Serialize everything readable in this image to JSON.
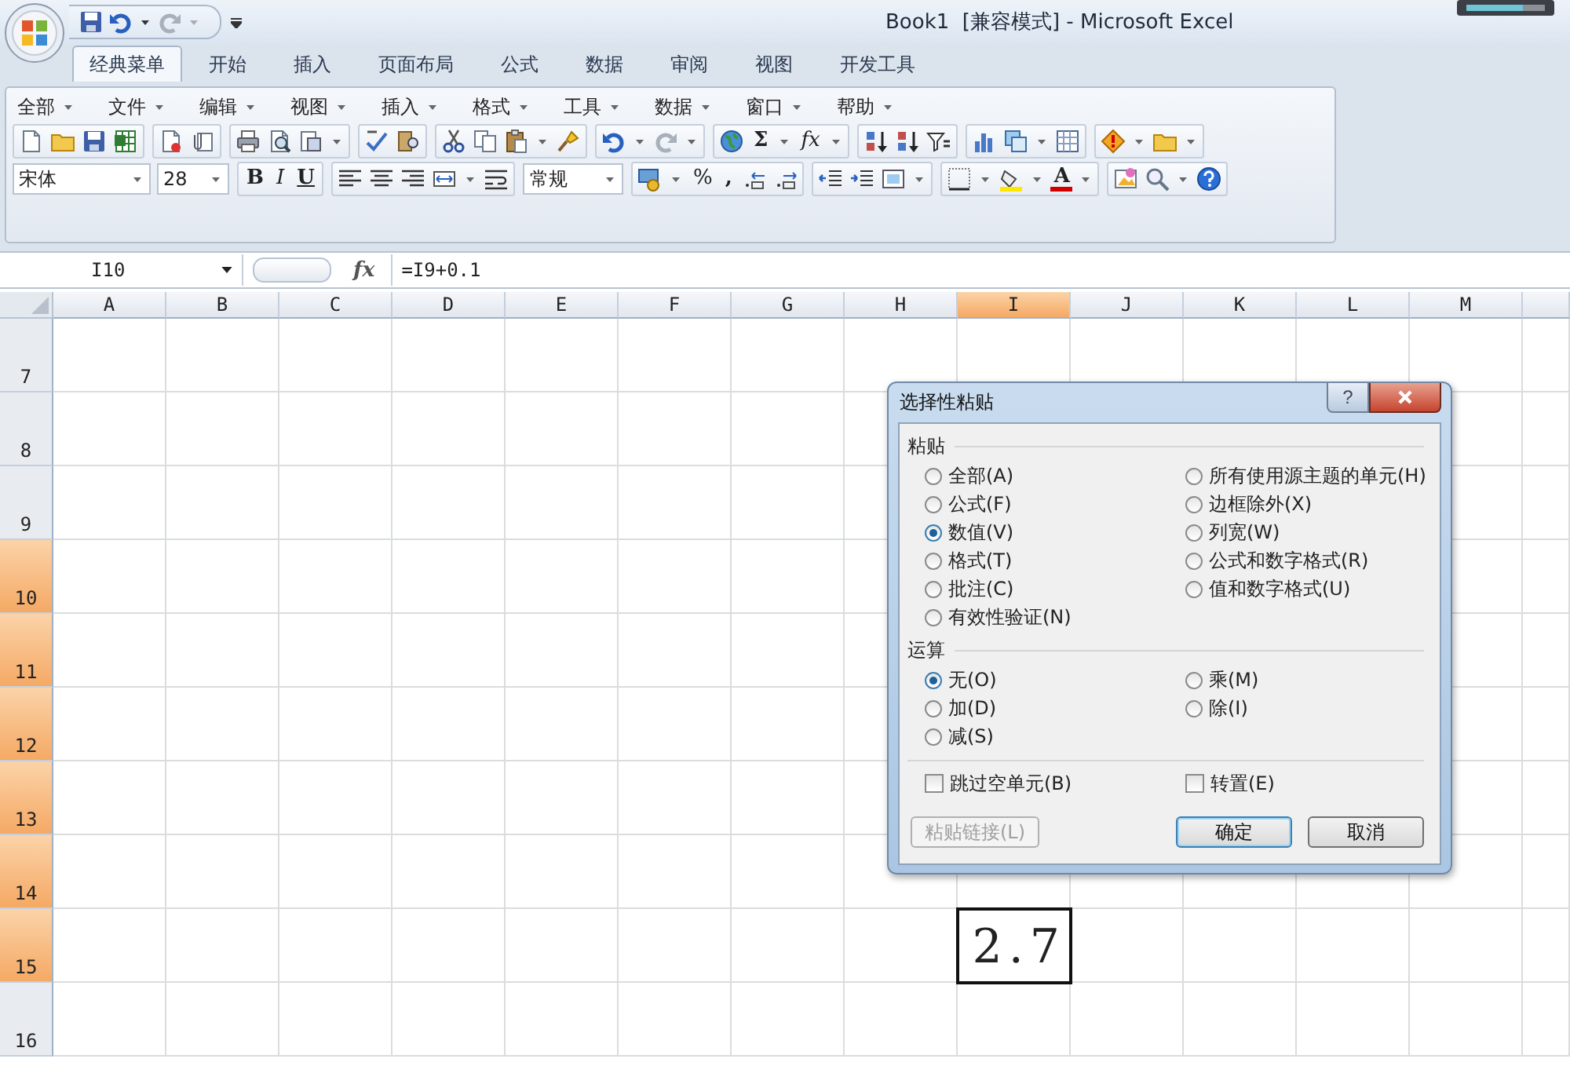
{
  "window": {
    "title": "Book1  [兼容模式] - Microsoft Excel"
  },
  "ribbon_tabs": [
    {
      "label": "经典菜单",
      "selected": true
    },
    {
      "label": "开始",
      "selected": false
    },
    {
      "label": "插入",
      "selected": false
    },
    {
      "label": "页面布局",
      "selected": false
    },
    {
      "label": "公式",
      "selected": false
    },
    {
      "label": "数据",
      "selected": false
    },
    {
      "label": "审阅",
      "selected": false
    },
    {
      "label": "视图",
      "selected": false
    },
    {
      "label": "开发工具",
      "selected": false
    }
  ],
  "menu": [
    "全部",
    "文件",
    "编辑",
    "视图",
    "插入",
    "格式",
    "工具",
    "数据",
    "窗口",
    "帮助"
  ],
  "standard_toolbar": {
    "sum": "Σ",
    "function": "fx"
  },
  "formatting_toolbar": {
    "font": "宋体",
    "size": "28",
    "bold": "B",
    "italic": "I",
    "underline": "U",
    "number_format": "常规",
    "percent": "%",
    "comma": ",",
    "font_color": "A"
  },
  "formula_bar": {
    "name_box": "I10",
    "fx": "fx",
    "formula": "=I9+0.1"
  },
  "columns": [
    {
      "label": "A",
      "selected": false
    },
    {
      "label": "B",
      "selected": false
    },
    {
      "label": "C",
      "selected": false
    },
    {
      "label": "D",
      "selected": false
    },
    {
      "label": "E",
      "selected": false
    },
    {
      "label": "F",
      "selected": false
    },
    {
      "label": "G",
      "selected": false
    },
    {
      "label": "H",
      "selected": false
    },
    {
      "label": "I",
      "selected": true
    },
    {
      "label": "J",
      "selected": false
    },
    {
      "label": "K",
      "selected": false
    },
    {
      "label": "L",
      "selected": false
    },
    {
      "label": "M",
      "selected": false
    }
  ],
  "rows": [
    {
      "label": "7",
      "selected": false
    },
    {
      "label": "8",
      "selected": false
    },
    {
      "label": "9",
      "selected": false
    },
    {
      "label": "10",
      "selected": true
    },
    {
      "label": "11",
      "selected": true
    },
    {
      "label": "12",
      "selected": true
    },
    {
      "label": "13",
      "selected": true
    },
    {
      "label": "14",
      "selected": true
    },
    {
      "label": "15",
      "selected": true,
      "cells": [
        null,
        null,
        null,
        null,
        null,
        null,
        null,
        null,
        "2.7",
        null,
        null,
        null,
        null
      ]
    },
    {
      "label": "16",
      "selected": false
    }
  ],
  "dialog": {
    "title": "选择性粘贴",
    "help": "?",
    "paste": {
      "label": "粘贴",
      "options": [
        {
          "label": "全部(A)",
          "selected": false
        },
        {
          "label": "公式(F)",
          "selected": false
        },
        {
          "label": "数值(V)",
          "selected": true
        },
        {
          "label": "格式(T)",
          "selected": false
        },
        {
          "label": "批注(C)",
          "selected": false
        },
        {
          "label": "有效性验证(N)",
          "selected": false
        },
        {
          "label": "所有使用源主题的单元(H)",
          "selected": false
        },
        {
          "label": "边框除外(X)",
          "selected": false
        },
        {
          "label": "列宽(W)",
          "selected": false
        },
        {
          "label": "公式和数字格式(R)",
          "selected": false
        },
        {
          "label": "值和数字格式(U)",
          "selected": false
        }
      ]
    },
    "operation": {
      "label": "运算",
      "options": [
        {
          "label": "无(O)",
          "selected": true
        },
        {
          "label": "加(D)",
          "selected": false
        },
        {
          "label": "减(S)",
          "selected": false
        },
        {
          "label": "乘(M)",
          "selected": false
        },
        {
          "label": "除(I)",
          "selected": false
        }
      ]
    },
    "checkboxes": [
      {
        "label": "跳过空单元(B)",
        "checked": false
      },
      {
        "label": "转置(E)",
        "checked": false
      }
    ],
    "buttons": [
      {
        "label": "粘贴链接(L)",
        "disabled": true,
        "default": false
      },
      {
        "label": "确定",
        "disabled": false,
        "default": true
      },
      {
        "label": "取消",
        "disabled": false,
        "default": false
      }
    ]
  }
}
